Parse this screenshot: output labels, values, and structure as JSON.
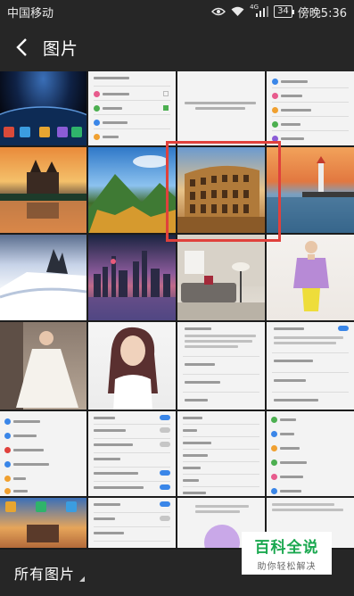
{
  "status_bar": {
    "carrier": "中国移动",
    "network": "4G",
    "battery": "34",
    "time": "傍晚5:36"
  },
  "header": {
    "back_icon": "chevron-left-icon",
    "title": "图片"
  },
  "bottom_bar": {
    "album": "所有图片"
  },
  "watermark": {
    "main": "百科全说",
    "sub": "助你轻松解决"
  },
  "colors": {
    "bar_bg": "#262626",
    "highlight": "#e0413c",
    "toggle_on": "#3a86e8",
    "watermark_green": "#1aa84f"
  }
}
